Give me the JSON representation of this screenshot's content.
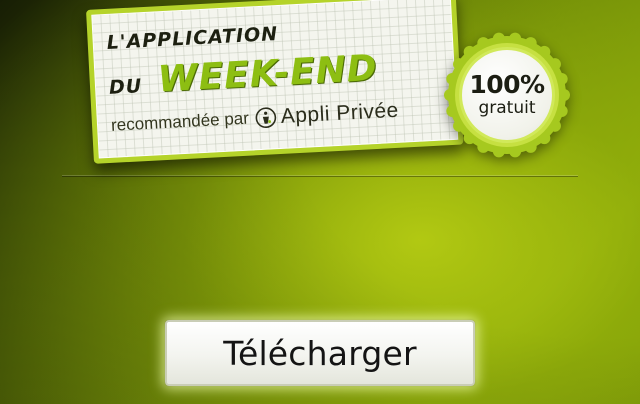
{
  "banner": {
    "headline_line1": "L'APPLICATION",
    "headline_line2_prefix": "DU",
    "headline_highlight": "WEEK-END",
    "recommendation": "recommandée par",
    "brand_icon": "appli-privee-logo-icon",
    "brand_name": "Appli Privée",
    "accent_color": "#b5d32a",
    "highlight_color": "#8dbe12"
  },
  "badge": {
    "percent": "100%",
    "label": "gratuit",
    "ring_color": "#a6c91f"
  },
  "download": {
    "label": "Télécharger"
  },
  "theme": {
    "background_colors": [
      "#1c2406",
      "#6e8a08",
      "#8aa80c"
    ]
  }
}
